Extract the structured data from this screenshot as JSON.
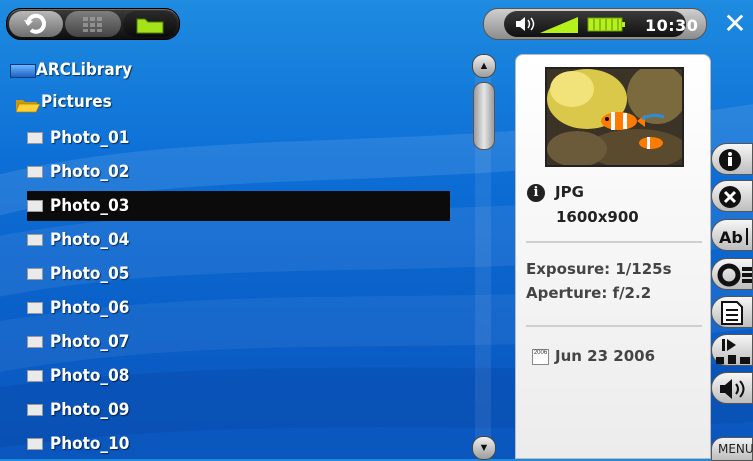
{
  "topbar": {
    "time": "10:30",
    "icons": [
      "refresh-icon",
      "grid-view-icon",
      "folder-icon",
      "speaker-icon",
      "volume-level-icon",
      "battery-icon",
      "close-icon"
    ]
  },
  "browser": {
    "items": [
      {
        "type": "root",
        "label": "ARCLibrary"
      },
      {
        "type": "folder",
        "label": "Pictures"
      },
      {
        "type": "file",
        "label": "Photo_01"
      },
      {
        "type": "file",
        "label": "Photo_02"
      },
      {
        "type": "file",
        "label": "Photo_03",
        "selected": true
      },
      {
        "type": "file",
        "label": "Photo_04"
      },
      {
        "type": "file",
        "label": "Photo_05"
      },
      {
        "type": "file",
        "label": "Photo_06"
      },
      {
        "type": "file",
        "label": "Photo_07"
      },
      {
        "type": "file",
        "label": "Photo_08"
      },
      {
        "type": "file",
        "label": "Photo_09"
      },
      {
        "type": "file",
        "label": "Photo_10"
      }
    ]
  },
  "info_panel": {
    "format": "JPG",
    "resolution": "1600x900",
    "exposure": "Exposure:  1/125s",
    "aperture": "Aperture:  f/2.2",
    "calendar_year": "2006",
    "date": "Jun 23 2006"
  },
  "toolbar": {
    "buttons": [
      "info-icon",
      "delete-icon",
      "rename-icon",
      "settings-icon",
      "playlist-icon",
      "slideshow-icon",
      "sound-icon"
    ],
    "menu_label": "MENU"
  }
}
